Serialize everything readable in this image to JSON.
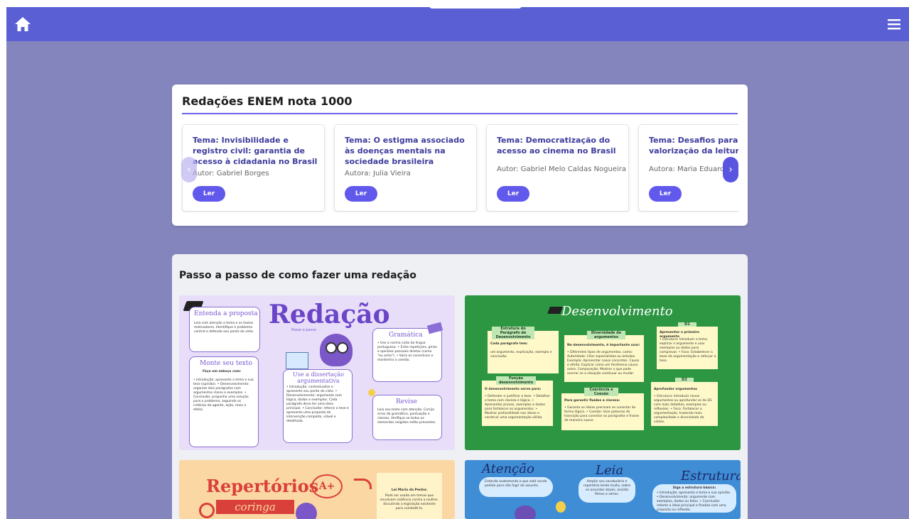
{
  "navbar": {
    "home_icon": "home-icon",
    "menu_icon": "menu-icon",
    "color": "#5a5fd4"
  },
  "essays": {
    "section_title": "Redações ENEM nota 1000",
    "read_label": "Ler",
    "items": [
      {
        "title": "Tema: Invisibilidade e registro civil: garantia de acesso à cidadania no Brasil",
        "author": "Autor: Gabriel Borges"
      },
      {
        "title": "Tema: O estigma associado às doenças mentais na sociedade brasileira",
        "author": "Autora: Julia Vieira"
      },
      {
        "title": "Tema: Democratização do acesso ao cinema no Brasil",
        "author": "Autor: Gabriel Melo Caldas Nogueira"
      },
      {
        "title": "Tema: Desafios para a valorização da leitura no Brasil",
        "author": "Autora: Maria Eduarda Br"
      }
    ]
  },
  "steps": {
    "section_title": "Passo a passo de como fazer uma redação",
    "redacao": {
      "title": "Redação",
      "subtitle": "Passo a passo",
      "entenda": {
        "head": "Entenda a proposta",
        "text": "Leia com atenção o tema e os textos motivadores. Identifique o problema central e defenda seu ponto de vista."
      },
      "monte": {
        "head": "Monte seu texto",
        "sub": "Faça um esboço com:",
        "text": "• Introdução: apresente o tema e sua tese (opinião). • Desenvolvimento: organize dois parágrafos com argumentos claros e exemplos. • Conclusão: proponha uma solução para o problema, seguindo os critérios de agente, ação, meio e efeito."
      },
      "dissertacao": {
        "head": "Use a dissertação argumentativa",
        "text": "• Introdução: contextualize e apresente seu ponto de vista. • Desenvolvimento: argumente com lógica, dados e exemplos. Cada parágrafo deve ter uma ideia principal. • Conclusão: reforce a tese e apresente uma proposta de intervenção completa, viável e detalhada."
      },
      "gramatica": {
        "head": "Gramática",
        "text": "• Use a norma culta da língua portuguesa. • Evite repetições, gírias e opiniões pessoais diretas (como \"eu acho\"). • Varie os conectivos e mantenha a coesão."
      },
      "revise": {
        "head": "Revise",
        "text": "Leia seu texto com atenção. Corrija erros de gramática, pontuação e clareza. Verifique se todos os elementos exigidos estão presentes."
      }
    },
    "desenvolvimento": {
      "title": "Desenvolvimento",
      "n1": {
        "head": "Estrutura do Parágrafo de Desenvolvimento",
        "sub": "Cada parágrafo tem:",
        "text": "um argumento, explicação, exemplo e conclusão."
      },
      "n2": {
        "head": "Diversidade de argumentos",
        "sub": "No desenvolvimento, é importante usar:",
        "text": "• Diferentes tipos de argumentos, como: Autoridade: Citar especialistas ou estudos. Exemplo: Apresentar casos concretos. Causa e efeito: Explicar como um fenômeno causa outro. Comparação: Mostrar o que pode ocorrer se a situação continuar ou mudar."
      },
      "n3": {
        "head": "D1",
        "sub": "Apresentar o primeiro argumento",
        "text": "• Estrutura: Introduzir o tema, explicar o argumento e usar exemplos ou dados para comprovar. • Foco: Estabelecer a base da argumentação e reforçar a tese."
      },
      "n4": {
        "head": "Função desenvolvimento",
        "sub": "O desenvolvimento serve para:",
        "text": "• Defender e justificar a tese. • Detalhar o tema com clareza e lógica. • Apresentar provas, exemplos e dados para fortalecer os argumentos. • Mostrar profundidade nas ideias e construir uma argumentação sólida."
      },
      "n5": {
        "head": "Coerência e Coesão",
        "sub": "Para garantir fluidez e clareza:",
        "text": "• Garanta as ideias precisam se conectar de forma lógica. • Coesão: Usar palavras de transição para conectar os parágrafos e frases de maneira suave."
      },
      "n6": {
        "head": "D2",
        "sub": "Aprofundar argumentos",
        "text": "• Estrutura: Introduzir novos argumentos ou aprofundar os do D1 com mais detalhes, exemplos ou reflexões. • Foco: Fortalecer a argumentação, trazendo mais complexidade e diversidade de visões."
      }
    },
    "repertorios": {
      "title": "Repertórios",
      "grade": "A+",
      "coringa": "coringa",
      "note_head": "Lei Maria da Penha:",
      "note_text": "Pode ser usada em temas que envolvam violência contra a mulher, discutindo a legislação existente para combatê-la."
    },
    "atencao": {
      "atencao": "Atenção",
      "atencao_text": "Entenda exatamente o que está sendo pedido para não fugir do assunto.",
      "leia": "Leia",
      "leia_text": "Amplie seu vocabulário e repertório lendo muito, sobre os assuntos atuais, assista filmes e séries.",
      "estrutura": "Estrutura",
      "estrutura_sub": "Siga a estrutura básica:",
      "estrutura_text": "• Introdução: apresente o tema e sua opinião. • Desenvolvimento: argumente com exemplos, dados ou fatos. • Conclusão: retome a ideia principal e finalize com uma proposta ou reflexão."
    }
  }
}
